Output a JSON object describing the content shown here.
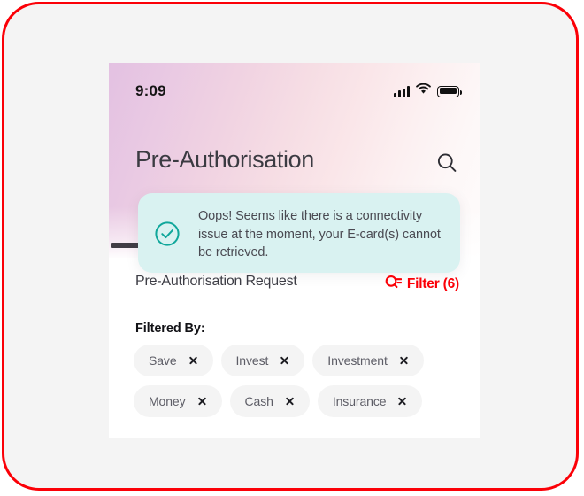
{
  "frame": {
    "border_color": "#fb0007",
    "background_color": "#f4f4f4"
  },
  "phone": {
    "status_bar": {
      "time": "9:09",
      "signal_icon": "cellular-signal-icon",
      "wifi_icon": "wifi-icon",
      "battery_icon": "battery-full-icon"
    },
    "header": {
      "title": "Pre-Authorisation",
      "search_icon": "search-icon",
      "gradient_from": "#e3c1e2",
      "gradient_to": "#fefcfc"
    },
    "toast": {
      "icon": "check-circle-icon",
      "icon_color": "#10a79b",
      "background_color": "#d9f2f1",
      "message": "Oops! Seems like there is a connectivity issue at the moment, your E-card(s) cannot be retrieved."
    },
    "request_row": {
      "label": "Pre-Authorisation Request",
      "filter_icon": "filter-search-icon",
      "filter_label": "Filter (6)",
      "filter_color": "#fb0007"
    },
    "filtered_by": {
      "label": "Filtered By:",
      "chips": [
        {
          "label": "Save",
          "close_icon": "close-icon"
        },
        {
          "label": "Invest",
          "close_icon": "close-icon"
        },
        {
          "label": "Investment",
          "close_icon": "close-icon"
        },
        {
          "label": "Money",
          "close_icon": "close-icon"
        },
        {
          "label": "Cash",
          "close_icon": "close-icon"
        },
        {
          "label": "Insurance",
          "close_icon": "close-icon"
        }
      ]
    }
  }
}
